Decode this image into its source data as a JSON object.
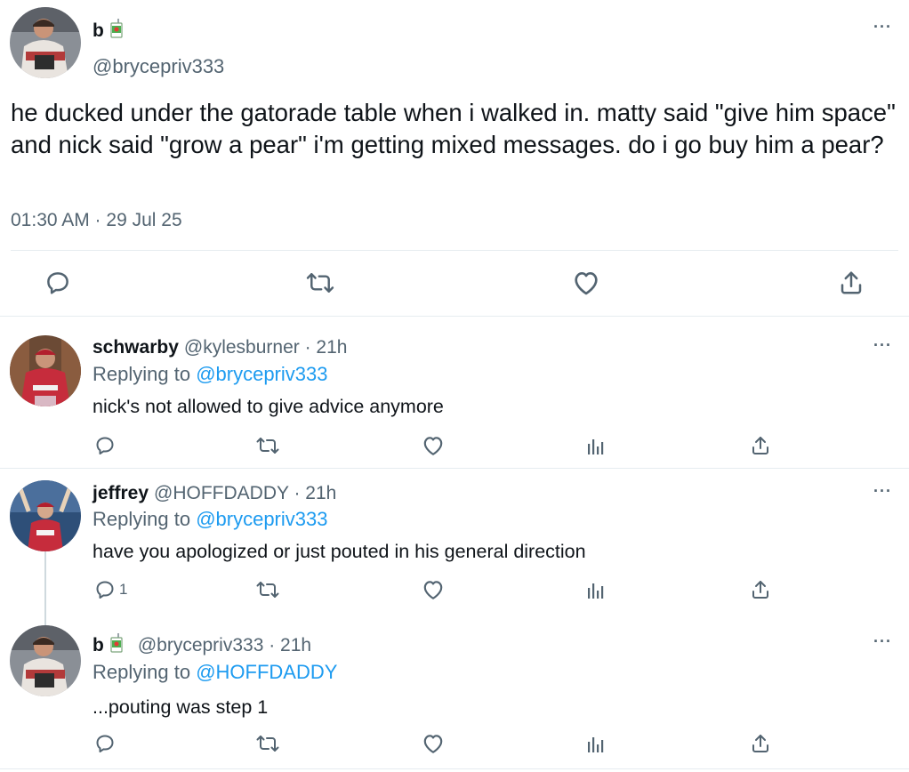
{
  "main_tweet": {
    "display_name": "b",
    "handle": "@brycepriv333",
    "text": "he ducked under the gatorade table when i walked in. matty said \"give him space\" and nick said \"grow a pear\" i'm getting mixed messages. do i go buy him a pear?",
    "timestamp": "01:30 AM · 29 Jul 25",
    "more": "···",
    "icons": [
      "reply-icon",
      "retweet-icon",
      "like-icon",
      "share-icon"
    ]
  },
  "replies": [
    {
      "display_name": "schwarby",
      "handle_time": "@kylesburner · 21h",
      "replying_prefix": "Replying to ",
      "replying_to": "@brycepriv333",
      "text": "nick's not allowed to give advice anymore",
      "reply_count": "",
      "more": "···"
    },
    {
      "display_name": "jeffrey",
      "handle_time": "@HOFFDADDY · 21h",
      "replying_prefix": "Replying to ",
      "replying_to": "@brycepriv333",
      "text": "have you apologized or just pouted in his general direction",
      "reply_count": "1",
      "more": "···"
    },
    {
      "display_name": "b",
      "handle_time": "@brycepriv333 · 21h",
      "replying_prefix": "Replying to ",
      "replying_to": "@HOFFDADDY",
      "text": "...pouting was step 1",
      "reply_count": "",
      "more": "···"
    }
  ],
  "colors": {
    "text": "#0f1419",
    "secondary": "#536471",
    "link": "#1d9bf0",
    "divider": "#e6ecf0"
  }
}
